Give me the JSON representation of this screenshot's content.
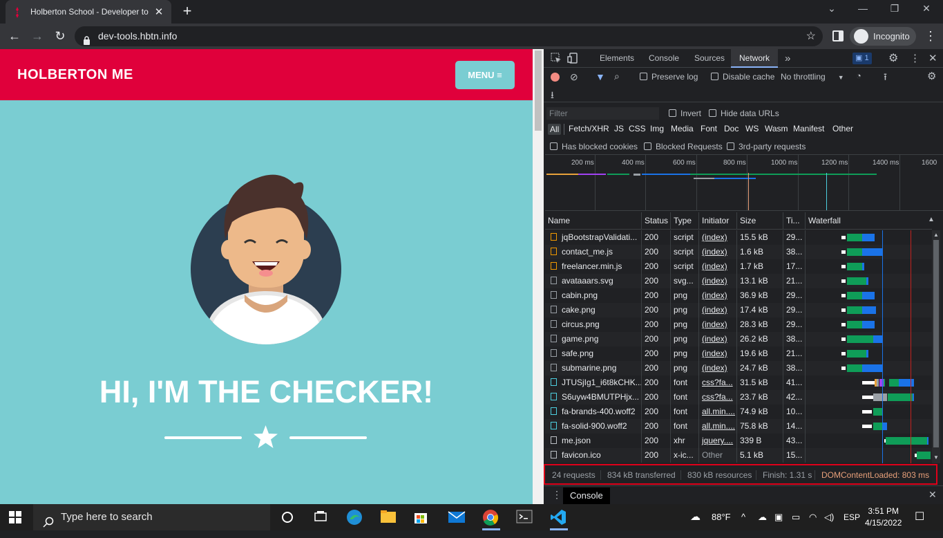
{
  "browser": {
    "tab_title": "Holberton School - Developer to",
    "url": "dev-tools.hbtn.info",
    "profile_label": "Incognito"
  },
  "page": {
    "brand": "HOLBERTON ME",
    "menu_label": "MENU",
    "heading": "HI, I'M THE CHECKER!"
  },
  "devtools": {
    "tabs": [
      "Elements",
      "Console",
      "Sources",
      "Network"
    ],
    "active_tab": "Network",
    "more_tabs": "»",
    "issues_count": "1",
    "preserve_log": "Preserve log",
    "disable_cache": "Disable cache",
    "throttling": "No throttling",
    "filter_placeholder": "Filter",
    "invert": "Invert",
    "hide_data_urls": "Hide data URLs",
    "type_filters": [
      "All",
      "Fetch/XHR",
      "JS",
      "CSS",
      "Img",
      "Media",
      "Font",
      "Doc",
      "WS",
      "Wasm",
      "Manifest",
      "Other"
    ],
    "has_blocked_cookies": "Has blocked cookies",
    "blocked_requests": "Blocked Requests",
    "third_party": "3rd-party requests",
    "timeline_ticks": [
      "200 ms",
      "400 ms",
      "600 ms",
      "800 ms",
      "1000 ms",
      "1200 ms",
      "1400 ms",
      "1600"
    ],
    "columns": [
      "Name",
      "Status",
      "Type",
      "Initiator",
      "Size",
      "Ti...",
      "Waterfall"
    ],
    "rows": [
      {
        "name": "jqBootstrapValidati...",
        "status": "200",
        "type": "script",
        "initiator": "(index)",
        "size": "15.5 kB",
        "time": "29...",
        "icon": "script-icon"
      },
      {
        "name": "contact_me.js",
        "status": "200",
        "type": "script",
        "initiator": "(index)",
        "size": "1.6 kB",
        "time": "38...",
        "icon": "script-icon"
      },
      {
        "name": "freelancer.min.js",
        "status": "200",
        "type": "script",
        "initiator": "(index)",
        "size": "1.7 kB",
        "time": "17...",
        "icon": "script-icon"
      },
      {
        "name": "avataaars.svg",
        "status": "200",
        "type": "svg...",
        "initiator": "(index)",
        "size": "13.1 kB",
        "time": "21...",
        "icon": "image-icon"
      },
      {
        "name": "cabin.png",
        "status": "200",
        "type": "png",
        "initiator": "(index)",
        "size": "36.9 kB",
        "time": "29...",
        "icon": "image-icon"
      },
      {
        "name": "cake.png",
        "status": "200",
        "type": "png",
        "initiator": "(index)",
        "size": "17.4 kB",
        "time": "29...",
        "icon": "image-icon"
      },
      {
        "name": "circus.png",
        "status": "200",
        "type": "png",
        "initiator": "(index)",
        "size": "28.3 kB",
        "time": "29...",
        "icon": "image-icon"
      },
      {
        "name": "game.png",
        "status": "200",
        "type": "png",
        "initiator": "(index)",
        "size": "26.2 kB",
        "time": "38...",
        "icon": "image-icon"
      },
      {
        "name": "safe.png",
        "status": "200",
        "type": "png",
        "initiator": "(index)",
        "size": "19.6 kB",
        "time": "21...",
        "icon": "image-icon"
      },
      {
        "name": "submarine.png",
        "status": "200",
        "type": "png",
        "initiator": "(index)",
        "size": "24.7 kB",
        "time": "38...",
        "icon": "image-icon"
      },
      {
        "name": "JTUSjIg1_i6t8kCHK...",
        "status": "200",
        "type": "font",
        "initiator": "css?fa...",
        "size": "31.5 kB",
        "time": "41...",
        "icon": "font-icon"
      },
      {
        "name": "S6uyw4BMUTPHjx...",
        "status": "200",
        "type": "font",
        "initiator": "css?fa...",
        "size": "23.7 kB",
        "time": "42...",
        "icon": "font-icon"
      },
      {
        "name": "fa-brands-400.woff2",
        "status": "200",
        "type": "font",
        "initiator": "all.min....",
        "size": "74.9 kB",
        "time": "10...",
        "icon": "font-icon"
      },
      {
        "name": "fa-solid-900.woff2",
        "status": "200",
        "type": "font",
        "initiator": "all.min....",
        "size": "75.8 kB",
        "time": "14...",
        "icon": "font-icon"
      },
      {
        "name": "me.json",
        "status": "200",
        "type": "xhr",
        "initiator": "jquery....",
        "size": "339 B",
        "time": "43...",
        "icon": "file-icon"
      },
      {
        "name": "favicon.ico",
        "status": "200",
        "type": "x-ic...",
        "initiator": "Other",
        "size": "5.1 kB",
        "time": "15...",
        "icon": "file-icon"
      }
    ],
    "summary": {
      "requests": "24 requests",
      "transferred": "834 kB transferred",
      "resources": "830 kB resources",
      "finish": "Finish: 1.31 s",
      "dom_loaded": "DOMContentLoaded: 803 ms"
    },
    "drawer_tab": "Console"
  },
  "taskbar": {
    "search_placeholder": "Type here to search",
    "weather": "88°F",
    "language": "ESP",
    "time": "3:51 PM",
    "date": "4/15/2022"
  },
  "colors": {
    "brand_red": "#e0003b",
    "page_teal": "#7acdd2",
    "waterfall_green": "#0f9d58",
    "waterfall_blue": "#1a73e8",
    "summary_highlight": "#e0001a"
  }
}
